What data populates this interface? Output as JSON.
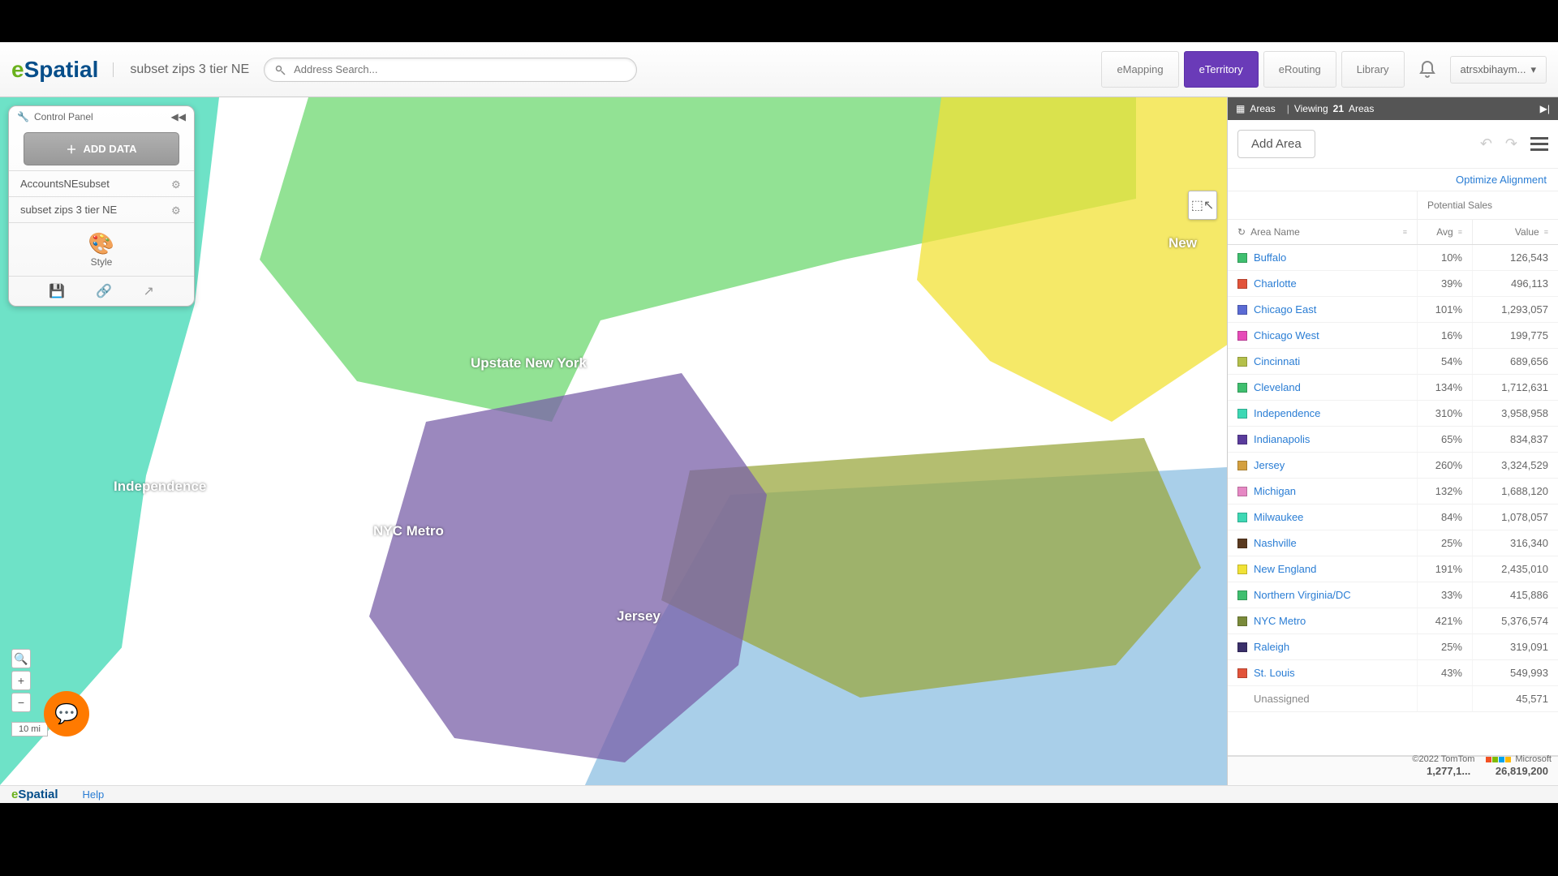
{
  "brand": {
    "pre": "e",
    "name": "Spatial"
  },
  "workspace": {
    "title": "subset zips 3 tier NE"
  },
  "search": {
    "placeholder": "Address Search..."
  },
  "nav": {
    "emapping": "eMapping",
    "eterritory": "eTerritory",
    "erouting": "eRouting",
    "library": "Library"
  },
  "user": {
    "name": "atrsxbihaym..."
  },
  "controlPanel": {
    "title": "Control Panel",
    "addData": "ADD DATA",
    "datasets": [
      "AccountsNEsubset",
      "subset zips 3 tier NE"
    ],
    "style": "Style"
  },
  "mapLabels": {
    "upstate": "Upstate New York",
    "independence": "Independence",
    "nycmetro": "NYC Metro",
    "jersey": "Jersey",
    "newengland": "New"
  },
  "zoom": {
    "scale": "10 mi"
  },
  "areasPanel": {
    "tab": "Areas",
    "viewing": "Viewing",
    "count": "21",
    "countLabel": "Areas",
    "addArea": "Add Area",
    "optimize": "Optimize Alignment",
    "colPotential": "Potential Sales",
    "colAreaName": "Area Name",
    "colAvg": "Avg",
    "colValue": "Value",
    "unassigned": "Unassigned",
    "unassignedVal": "45,571",
    "totalAvg": "1,277,1...",
    "totalVal": "26,819,200",
    "rows": [
      {
        "c": "#3fbf6f",
        "n": "Buffalo",
        "a": "10%",
        "v": "126,543"
      },
      {
        "c": "#e2533a",
        "n": "Charlotte",
        "a": "39%",
        "v": "496,113"
      },
      {
        "c": "#5b6bd4",
        "n": "Chicago East",
        "a": "101%",
        "v": "1,293,057"
      },
      {
        "c": "#e64bb8",
        "n": "Chicago West",
        "a": "16%",
        "v": "199,775"
      },
      {
        "c": "#b4c04a",
        "n": "Cincinnati",
        "a": "54%",
        "v": "689,656"
      },
      {
        "c": "#3fbf6f",
        "n": "Cleveland",
        "a": "134%",
        "v": "1,712,631"
      },
      {
        "c": "#3dd8b4",
        "n": "Independence",
        "a": "310%",
        "v": "3,958,958"
      },
      {
        "c": "#5a3c9c",
        "n": "Indianapolis",
        "a": "65%",
        "v": "834,837"
      },
      {
        "c": "#d4a03f",
        "n": "Jersey",
        "a": "260%",
        "v": "3,324,529"
      },
      {
        "c": "#e688c4",
        "n": "Michigan",
        "a": "132%",
        "v": "1,688,120"
      },
      {
        "c": "#3dd8b4",
        "n": "Milwaukee",
        "a": "84%",
        "v": "1,078,057"
      },
      {
        "c": "#5a3a20",
        "n": "Nashville",
        "a": "25%",
        "v": "316,340"
      },
      {
        "c": "#f1e236",
        "n": "New England",
        "a": "191%",
        "v": "2,435,010"
      },
      {
        "c": "#3fbf6f",
        "n": "Northern Virginia/DC",
        "a": "33%",
        "v": "415,886"
      },
      {
        "c": "#7a8a3a",
        "n": "NYC Metro",
        "a": "421%",
        "v": "5,376,574"
      },
      {
        "c": "#3a2f6a",
        "n": "Raleigh",
        "a": "25%",
        "v": "319,091"
      },
      {
        "c": "#e2533a",
        "n": "St. Louis",
        "a": "43%",
        "v": "549,993"
      }
    ]
  },
  "attribution": {
    "tomtom": "©2022 TomTom",
    "ms": "Microsoft"
  },
  "footer": {
    "help": "Help"
  }
}
